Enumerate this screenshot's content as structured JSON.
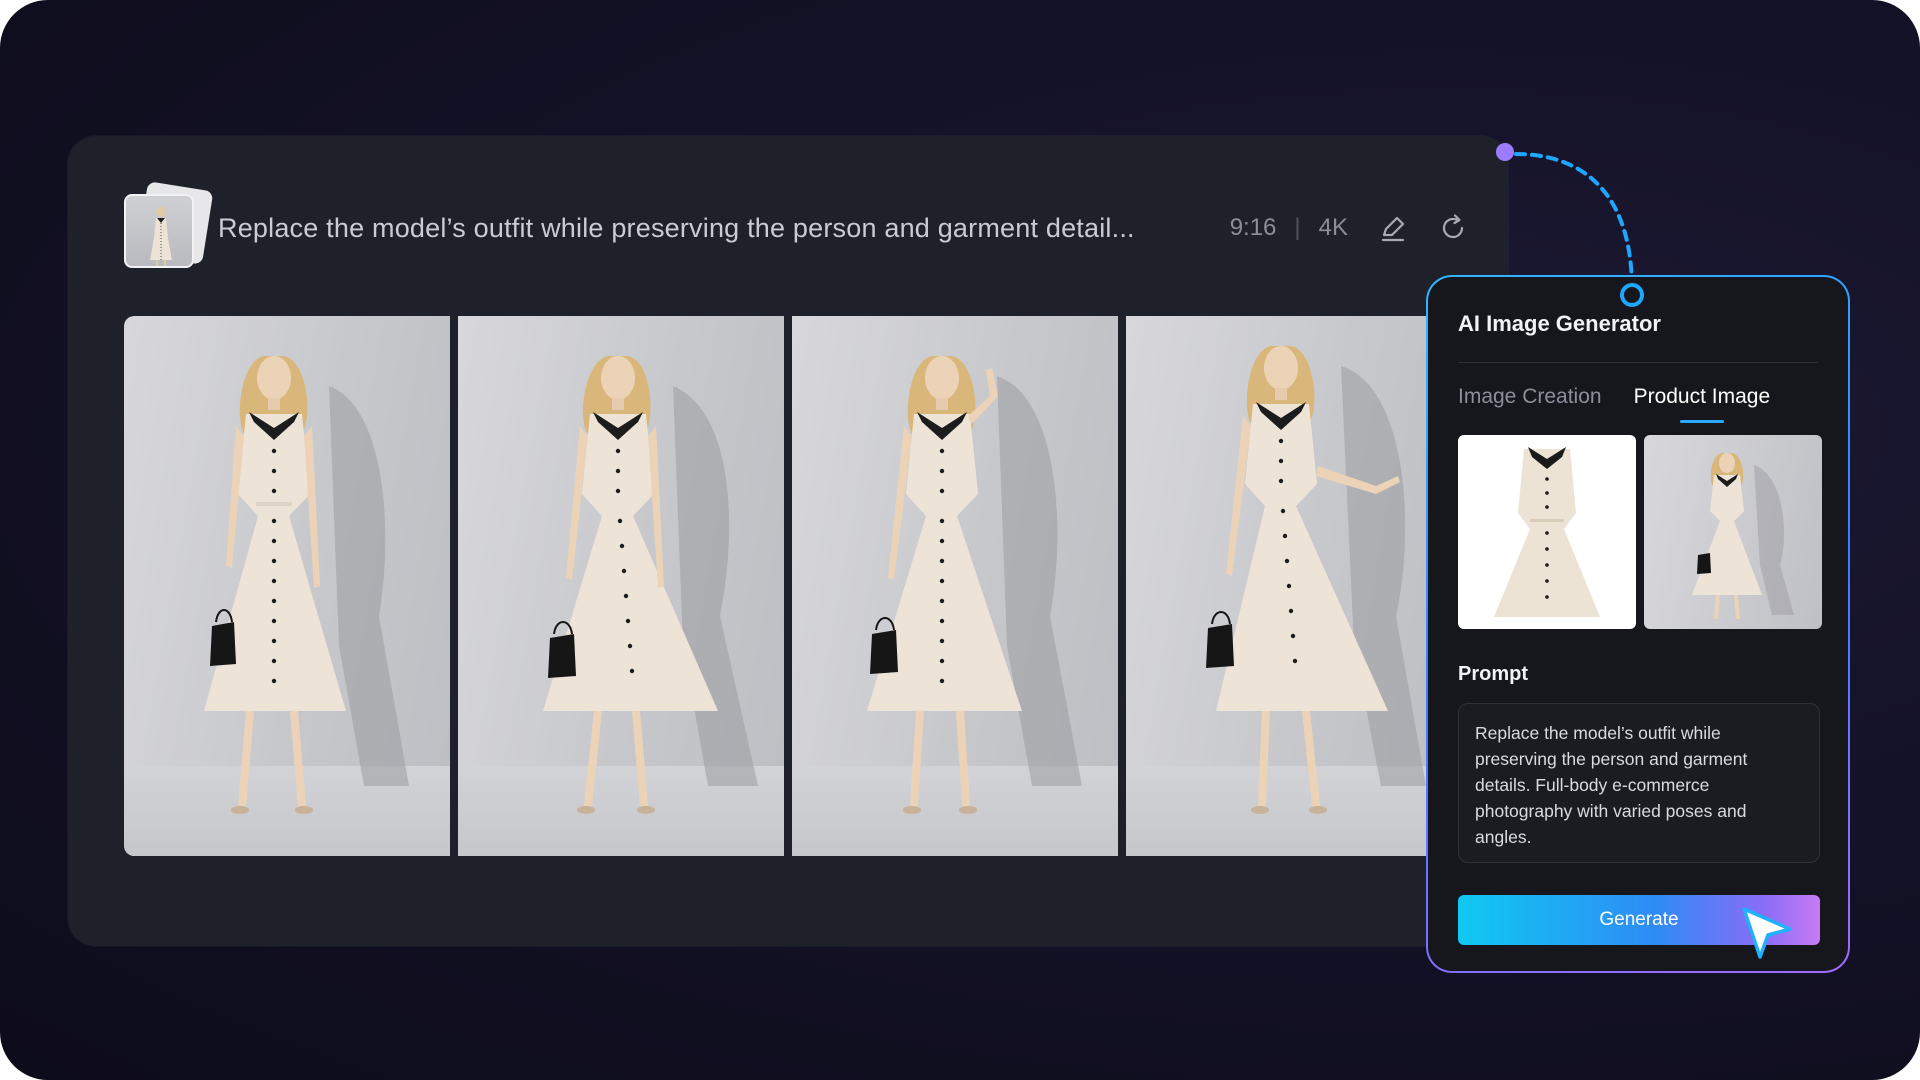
{
  "prompt_bar": {
    "prompt_text": "Replace the model’s outfit while preserving the person and garment detail...",
    "aspect_ratio": "9:16",
    "separator": "|",
    "resolution": "4K"
  },
  "icons": {
    "edit": "pencil-icon",
    "regenerate": "refresh-icon",
    "cursor": "pointer-cursor-icon"
  },
  "results": [
    {
      "label": "result-1"
    },
    {
      "label": "result-2"
    },
    {
      "label": "result-3"
    },
    {
      "label": "result-4"
    }
  ],
  "generator": {
    "title": "AI Image Generator",
    "tabs": [
      {
        "label": "Image Creation",
        "active": false
      },
      {
        "label": "Product Image",
        "active": true
      }
    ],
    "prompt_label": "Prompt",
    "prompt_value": "Replace the model’s outfit while preserving the person and garment details. Full-body e-commerce photography with varied poses and angles.",
    "generate_label": "Generate"
  },
  "colors": {
    "background": "#141227",
    "panel": "#1e2129",
    "card": "#15171c",
    "accent_blue": "#2aa8ff",
    "accent_purple": "#a36bff"
  }
}
